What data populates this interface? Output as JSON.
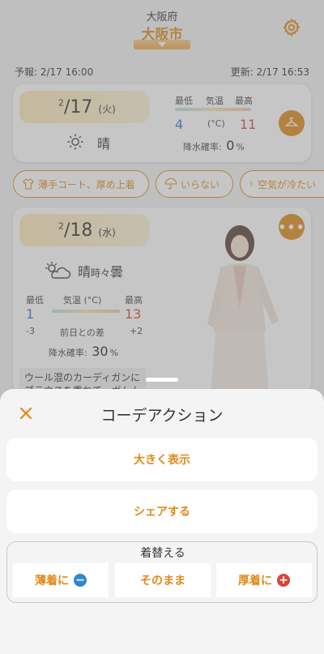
{
  "header": {
    "prefecture": "大阪府",
    "city": "大阪市",
    "forecast_time": "予報: 2/17 16:00",
    "updated_time": "更新: 2/17 16:53"
  },
  "today": {
    "month": "2",
    "day": "/17",
    "weekday": "(火)",
    "weather": "晴",
    "low_label": "最低",
    "temp_label": "気温",
    "high_label": "最高",
    "low": "4",
    "unit": "(°C)",
    "high": "11",
    "rain_label": "降水確率:",
    "rain_value": "0",
    "rain_unit": "%"
  },
  "chips": [
    {
      "label": "薄手コート、厚め上着",
      "icon": "jacket-icon"
    },
    {
      "label": "いらない",
      "icon": "umbrella-icon"
    },
    {
      "label": "空気が冷たい",
      "icon": "thermometer-icon"
    }
  ],
  "tomorrow": {
    "month": "2",
    "day": "/18",
    "weekday": "(水)",
    "weather_main": "晴",
    "weather_sub": "時々",
    "weather_end": "曇",
    "low_label": "最低",
    "temp_label": "気温 (°C)",
    "high_label": "最高",
    "low": "1",
    "high": "13",
    "low_diff": "-3",
    "diff_label": "前日との差",
    "high_diff": "+2",
    "rain_label": "降水確率:",
    "rain_value": "30",
    "rain_unit": "%",
    "description": "ウール混のカーディガンにブラウスを重ねて、ボトム"
  },
  "sheet": {
    "title": "コーデアクション",
    "large_view": "大きく表示",
    "share": "シェアする",
    "change_label": "着替える",
    "thinner": "薄着に",
    "same": "そのまま",
    "thicker": "厚着に"
  },
  "colors": {
    "accent": "#e08a18",
    "low_temp": "#2f7fc8",
    "high_temp": "#d9453a"
  }
}
